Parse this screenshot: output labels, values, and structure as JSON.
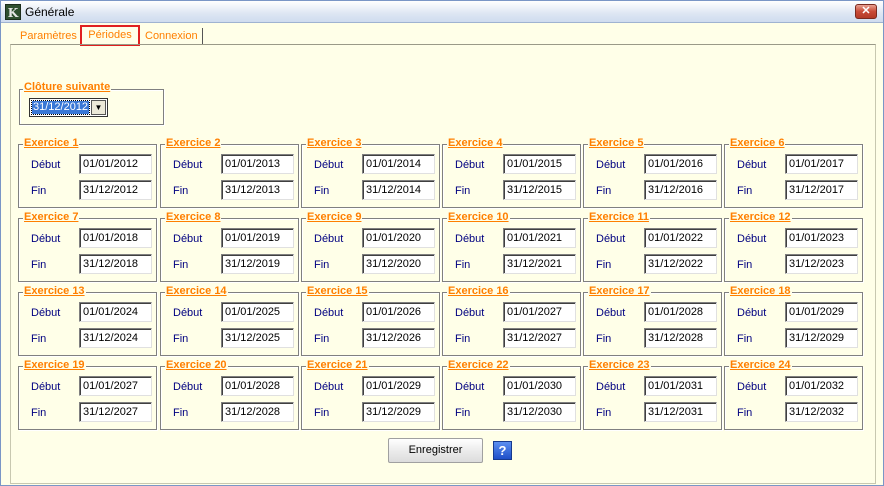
{
  "window": {
    "title": "Générale",
    "close_glyph": "✕",
    "app_icon_glyph": "K"
  },
  "tabs": [
    {
      "label": "Paramètres"
    },
    {
      "label": "Périodes"
    },
    {
      "label": "Connexion"
    }
  ],
  "cloture": {
    "label": "Clôture suivante",
    "value": "31/12/2012"
  },
  "labels": {
    "debut": "Début",
    "fin": "Fin"
  },
  "exercices": [
    {
      "title": "Exercice 1",
      "debut": "01/01/2012",
      "fin": "31/12/2012"
    },
    {
      "title": "Exercice 2",
      "debut": "01/01/2013",
      "fin": "31/12/2013"
    },
    {
      "title": "Exercice 3",
      "debut": "01/01/2014",
      "fin": "31/12/2014"
    },
    {
      "title": "Exercice 4",
      "debut": "01/01/2015",
      "fin": "31/12/2015"
    },
    {
      "title": "Exercice 5",
      "debut": "01/01/2016",
      "fin": "31/12/2016"
    },
    {
      "title": "Exercice 6",
      "debut": "01/01/2017",
      "fin": "31/12/2017"
    },
    {
      "title": "Exercice 7",
      "debut": "01/01/2018",
      "fin": "31/12/2018"
    },
    {
      "title": "Exercice 8",
      "debut": "01/01/2019",
      "fin": "31/12/2019"
    },
    {
      "title": "Exercice 9",
      "debut": "01/01/2020",
      "fin": "31/12/2020"
    },
    {
      "title": "Exercice 10",
      "debut": "01/01/2021",
      "fin": "31/12/2021"
    },
    {
      "title": "Exercice 11",
      "debut": "01/01/2022",
      "fin": "31/12/2022"
    },
    {
      "title": "Exercice 12",
      "debut": "01/01/2023",
      "fin": "31/12/2023"
    },
    {
      "title": "Exercice 13",
      "debut": "01/01/2024",
      "fin": "31/12/2024"
    },
    {
      "title": "Exercice 14",
      "debut": "01/01/2025",
      "fin": "31/12/2025"
    },
    {
      "title": "Exercice 15",
      "debut": "01/01/2026",
      "fin": "31/12/2026"
    },
    {
      "title": "Exercice 16",
      "debut": "01/01/2027",
      "fin": "31/12/2027"
    },
    {
      "title": "Exercice 17",
      "debut": "01/01/2028",
      "fin": "31/12/2028"
    },
    {
      "title": "Exercice 18",
      "debut": "01/01/2029",
      "fin": "31/12/2029"
    },
    {
      "title": "Exercice 19",
      "debut": "01/01/2027",
      "fin": "31/12/2027"
    },
    {
      "title": "Exercice 20",
      "debut": "01/01/2028",
      "fin": "31/12/2028"
    },
    {
      "title": "Exercice 21",
      "debut": "01/01/2029",
      "fin": "31/12/2029"
    },
    {
      "title": "Exercice 22",
      "debut": "01/01/2030",
      "fin": "31/12/2030"
    },
    {
      "title": "Exercice 23",
      "debut": "01/01/2031",
      "fin": "31/12/2031"
    },
    {
      "title": "Exercice 24",
      "debut": "01/01/2032",
      "fin": "31/12/2032"
    }
  ],
  "buttons": {
    "save": "Enregistrer",
    "help_glyph": "?"
  },
  "colors": {
    "accent_orange": "#ff7f00",
    "label_navy": "#000080",
    "panel_bg": "#ffffe8",
    "selected_tab_border": "#e02020"
  },
  "icons": {
    "app": "app-k-icon",
    "close": "close-icon",
    "dropdown": "chevron-down-icon",
    "help": "help-icon"
  }
}
